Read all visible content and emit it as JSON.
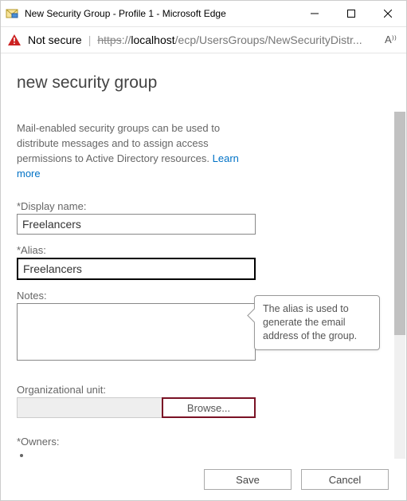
{
  "window": {
    "title": "New Security Group - Profile 1 - Microsoft Edge"
  },
  "address": {
    "not_secure": "Not secure",
    "scheme": "https",
    "sep": "://",
    "host": "localhost",
    "path": "/ecp/UsersGroups/NewSecurityDistr...",
    "read_aloud_label": "A⁾⁾"
  },
  "page": {
    "title": "new security group",
    "intro_text": "Mail-enabled security groups can be used to distribute messages and to assign access permissions to Active Directory resources. ",
    "learn_more": "Learn more"
  },
  "form": {
    "display_name": {
      "label": "*Display name:",
      "value": "Freelancers"
    },
    "alias": {
      "label": "*Alias:",
      "value": "Freelancers"
    },
    "notes": {
      "label": "Notes:",
      "value": ""
    },
    "ou": {
      "label": "Organizational unit:",
      "value": "",
      "browse": "Browse..."
    },
    "owners": {
      "label": "*Owners:"
    }
  },
  "tooltip": {
    "alias": "The alias is used to generate the email address of the group."
  },
  "footer": {
    "save": "Save",
    "cancel": "Cancel"
  }
}
